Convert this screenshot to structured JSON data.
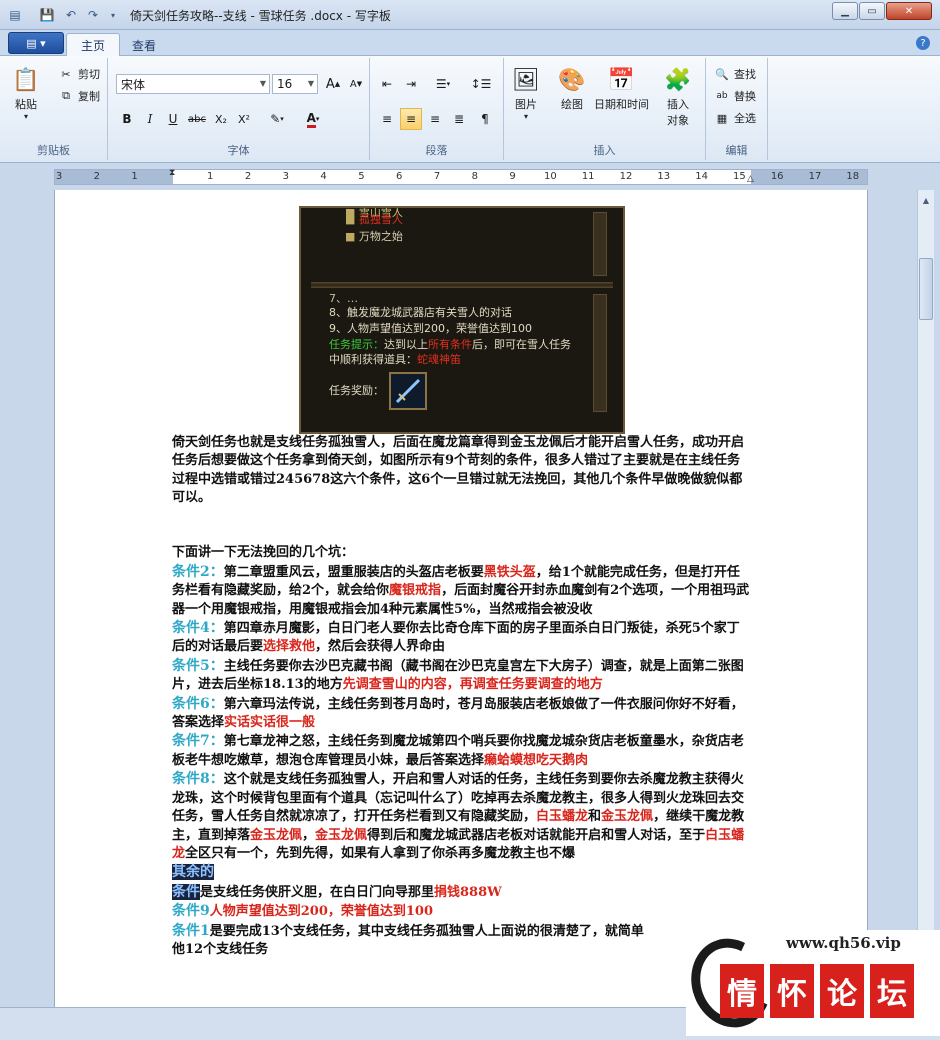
{
  "window": {
    "title": "倚天剑任务攻略--支线 - 雪球任务 .docx - 写字板"
  },
  "ribbon": {
    "tabs": [
      {
        "label": "主页"
      },
      {
        "label": "查看"
      }
    ],
    "clipboard": {
      "paste": "粘贴",
      "cut": "剪切",
      "copy": "复制",
      "group_label": "剪贴板"
    },
    "font": {
      "family": "宋体",
      "size": "16",
      "group_label": "字体",
      "bold": "B",
      "italic": "I",
      "underline": "U",
      "strike": "abc",
      "subscript": "X₂",
      "superscript": "X²",
      "color_letter": "A",
      "grow": "A",
      "shrink": "A"
    },
    "paragraph": {
      "group_label": "段落"
    },
    "insert": {
      "picture": "图片",
      "paint": "绘图",
      "datetime": "日期和时间",
      "object_line1": "插入",
      "object_line2": "对象",
      "group_label": "插入"
    },
    "editing": {
      "find": "查找",
      "replace": "替换",
      "select_all": "全选",
      "group_label": "编辑"
    }
  },
  "ruler": {
    "labels": [
      "3",
      "2",
      "1",
      "",
      "1",
      "2",
      "3",
      "4",
      "5",
      "6",
      "7",
      "8",
      "9",
      "10",
      "11",
      "12",
      "13",
      "14",
      "15",
      "16",
      "17",
      "18"
    ]
  },
  "game_screenshot": {
    "quest_items": [
      {
        "text": "雪山雪人",
        "color": "#c9c07a"
      },
      {
        "text": "孤独雪人",
        "color": "#e0301e"
      },
      {
        "text": "万物之始",
        "color": "#d8d0b0"
      }
    ],
    "conditions": [
      {
        "text": "7、…",
        "color": "#c8c0a0"
      },
      {
        "text": "8、触发魔龙城武器店有关雪人的对话",
        "color": "#e0d8c0"
      },
      {
        "text": "9、人物声望值达到200，荣誉值达到100",
        "color": "#e0d8c0"
      }
    ],
    "hint_label": "任务提示：",
    "hint_mid": "达到以上",
    "hint_cond": "所有条件",
    "hint_tail": "后，即可在雪人任务",
    "hint_line2": "中顺利获得道具：",
    "hint_item": "蛇魂神笛",
    "reward_label": "任务奖励："
  },
  "document": {
    "intro": "倚天剑任务也就是支线任务孤独雪人，后面在魔龙篇章得到金玉龙佩后才能开启雪人任务，成功开启任务后想要做这个任务拿到倚天剑，如图所示有9个苛刻的条件，很多人错过了主要就是在主线任务过程中选错或错过245678这六个条件，这6个一旦错过就无法挽回，其他几个条件早做晚做貌似都可以。",
    "subheading": "下面讲一下无法挽回的几个坑：",
    "c2_label": "条件2：",
    "c2_a": "第二章盟重风云，盟重服装店的头盔店老板要",
    "c2_r1": "黑铁头盔",
    "c2_b": "，给1个就能完成任务，但是打开任务栏看有隐藏奖励，给2个，就会给你",
    "c2_r2": "魔银戒指",
    "c2_c": "，后面封魔谷开封赤血魔剑有2个选项，一个用祖玛武器一个用魔银戒指，用魔银戒指会加4种元素属性5%，当然戒指会被没收",
    "c4_label": "条件4：",
    "c4_a": "第四章赤月魔影，白日门老人要你去比奇仓库下面的房子里面杀白日门叛徒，杀死5个家丁后的对话最后要",
    "c4_r1": "选择救他",
    "c4_b": "，然后会获得人界命由",
    "c5_label": "条件5：",
    "c5_a": "主线任务要你去沙巴克藏书阁（藏书阁在沙巴克皇宫左下大房子）调查，就是上面第二张图片，进去后坐标18.13的地方",
    "c5_r1": "先调查雪山的内容，再调查任务要调查的地方",
    "c6_label": "条件6：",
    "c6_a": "第六章玛法传说，主线任务到苍月岛时，苍月岛服装店老板娘做了一件衣服问你好不好看，答案选择",
    "c6_r1": "实话实话很一般",
    "c7_label": "条件7：",
    "c7_a": "第七章龙神之怒，主线任务到魔龙城第四个哨兵要你找魔龙城杂货店老板童墨水，杂货店老板老牛想吃嫩草，想泡仓库管理员小妹，最后答案选择",
    "c7_r1": "癞蛤蟆想吃天鹅肉",
    "c8_label": "条件8：",
    "c8_a": "这个就是支线任务孤独雪人，开启和雪人对话的任务，主线任务到要你去杀魔龙教主获得火龙珠，这个时候背包里面有个道具（忘记叫什么了）吃掉再去杀魔龙教主，很多人得到火龙珠回去交任务，雪人任务自然就凉凉了，打开任务栏看到又有隐藏奖励，",
    "c8_r1": "白玉蟠龙",
    "c8_b": "和",
    "c8_r2": "金玉龙佩",
    "c8_c": "，继续干魔龙教主，直到掉落",
    "c8_r3": "金玉龙佩",
    "c8_d": "，",
    "c8_r4": "金玉龙佩",
    "c8_e": "得到后和魔龙城武器店老板对话就能开启和雪人对话，至于",
    "c8_r5": "白玉蟠龙",
    "c8_f": "全区只有一个，先到先得，如果有人拿到了你杀再多魔龙教主也不爆",
    "rest_heading": "其余的",
    "c_rest_label": "条件",
    "c_rest_a": "是支线任务侠肝义胆，在白日门向导那里",
    "c_rest_r1": "捐钱888W",
    "c9_label": "条件9",
    "c9_r1": "人物声望值达到200，荣誉值达到100",
    "c1_label": "条件1",
    "c1_a": "是要完成13个支线任务，其中支线任务孤独雪人上面说的很清楚了，就简单",
    "c1_b": "他12个支线任务"
  },
  "watermark": {
    "url": "www.qh56.vip",
    "chars": [
      "情",
      "怀",
      "论",
      "坛"
    ]
  },
  "colors": {
    "condition_label": "#2fa8c8",
    "highlight_red": "#d9261c",
    "ribbon_bg": "#dde8f5"
  }
}
